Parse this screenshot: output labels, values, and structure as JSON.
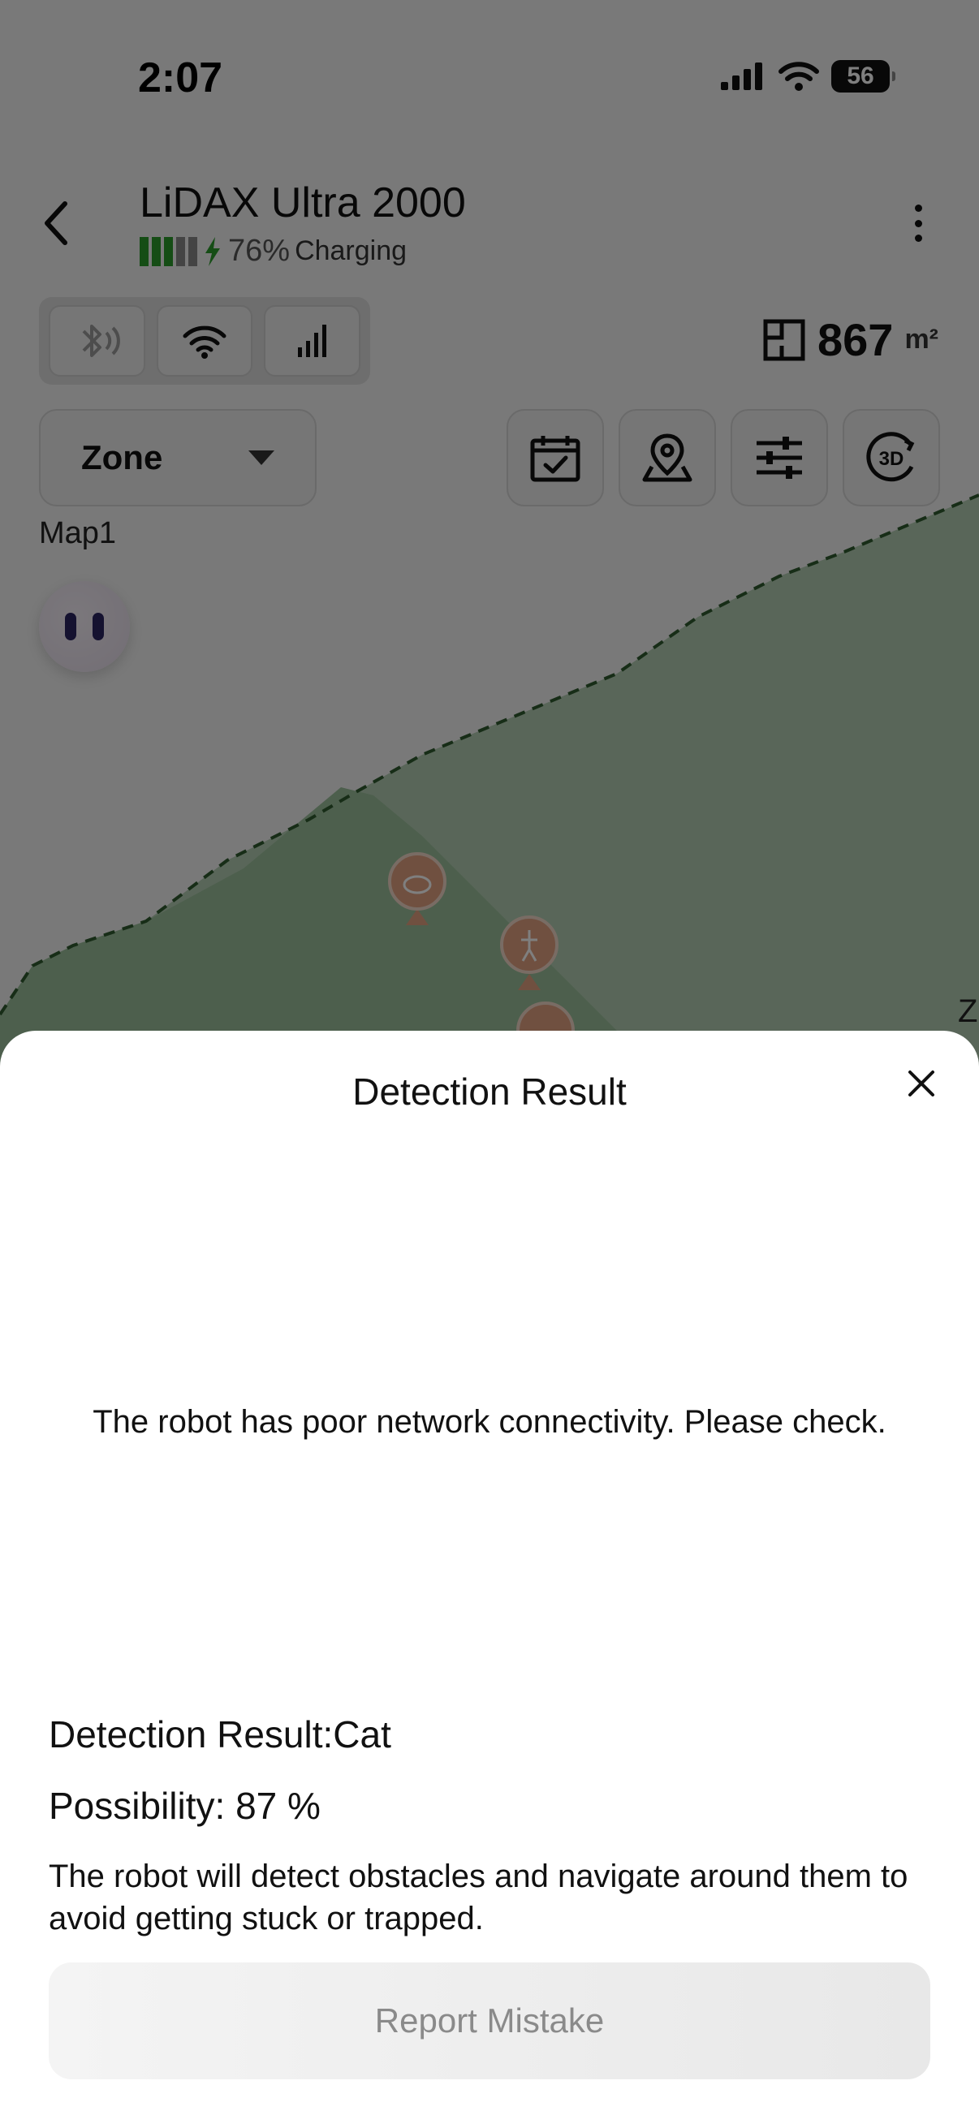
{
  "status_bar": {
    "time": "2:07",
    "battery_level": "56",
    "icons": [
      "cellular-signal-icon",
      "wifi-icon",
      "battery-icon"
    ]
  },
  "header": {
    "title": "LiDAX Ultra 2000",
    "battery_percent": "76%",
    "charging_label": "Charging",
    "battery_bars_filled": 3,
    "battery_bars_total": 5
  },
  "connectivity": [
    "bluetooth-icon",
    "wifi-icon",
    "cellular-icon"
  ],
  "area": {
    "value": "867",
    "unit": "m²"
  },
  "zone_select": {
    "selected": "Zone"
  },
  "toolbar": [
    "schedule-icon",
    "map-pin-icon",
    "settings-sliders-icon",
    "3d-view-icon"
  ],
  "map": {
    "name": "Map1",
    "edge_label": "Z",
    "markers": [
      "cat-marker-icon",
      "person-marker-icon",
      "person-marker-icon"
    ],
    "colors": {
      "lawn": "#6e936e",
      "lawn_dark": "#4f7d4f",
      "boundary": "#2e5a2e",
      "marker": "#d79a7b"
    }
  },
  "sheet": {
    "title": "Detection Result",
    "network_message": "The robot has poor network connectivity. Please check.",
    "result_label": "Detection Result:Cat",
    "possibility_label": "Possibility: 87 %",
    "description": "The robot will detect obstacles and navigate around them to avoid getting stuck or trapped.",
    "report_button": "Report Mistake"
  }
}
